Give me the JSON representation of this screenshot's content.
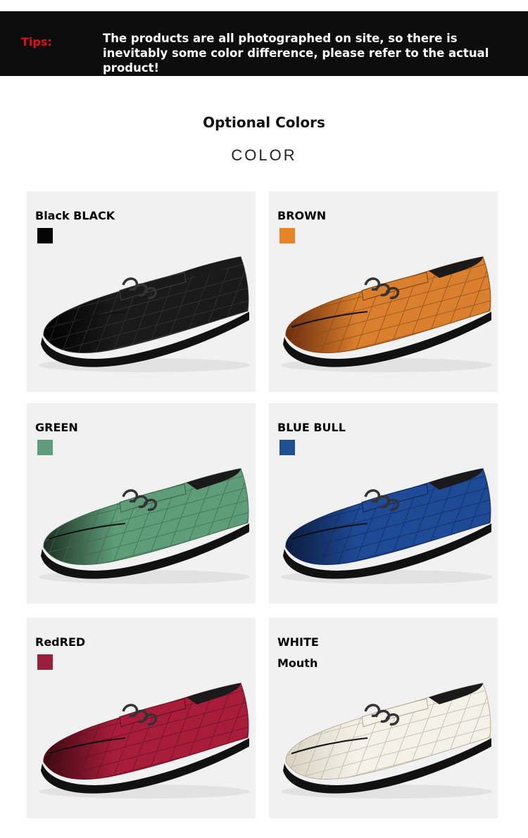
{
  "tips": {
    "label": "Tips:",
    "text": "The products are all photographed on site, so there is inevitably some color difference, please refer to the actual product!"
  },
  "section": {
    "title": "Optional Colors",
    "subtitle": "COLOR"
  },
  "colors": [
    {
      "name": "Black BLACK",
      "swatch": "#050505",
      "upper": "#1a1a1a",
      "upper_dark": "#000000",
      "line": "#3a3a3a"
    },
    {
      "name": "BROWN",
      "swatch": "#e88428",
      "upper": "#d97f2e",
      "upper_dark": "#6a2c0c",
      "line": "#8a4a18"
    },
    {
      "name": "GREEN",
      "swatch": "#5e9c7e",
      "upper": "#5f9d78",
      "upper_dark": "#1d2e22",
      "line": "#3e6a50"
    },
    {
      "name": "BLUE BULL",
      "swatch": "#1f4e93",
      "upper": "#1f4a96",
      "upper_dark": "#0b1b3c",
      "line": "#112c5e"
    },
    {
      "name": "RedRED",
      "swatch": "#9b1f3a",
      "upper": "#a81e3a",
      "upper_dark": "#3a0812",
      "line": "#6a1022"
    },
    {
      "name": "WHITE\nMouth",
      "swatch": "",
      "upper": "#f4f1e8",
      "upper_dark": "#d8d2c2",
      "line": "#b9b09a"
    }
  ]
}
